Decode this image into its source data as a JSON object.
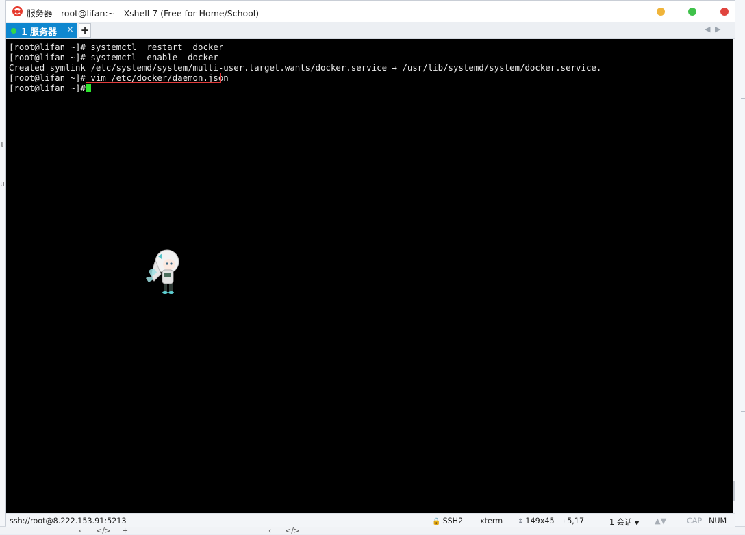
{
  "window": {
    "title": "服务器 - root@lifan:~ - Xshell 7 (Free for Home/School)"
  },
  "tabs": [
    {
      "number": "1",
      "label": "服务器",
      "close": "×",
      "active": true
    }
  ],
  "tab_add_label": "+",
  "tab_nav": {
    "prev": "◀",
    "next": "▶"
  },
  "terminal": {
    "lines": [
      "[root@lifan ~]# systemctl  restart  docker",
      "[root@lifan ~]# systemctl  enable  docker",
      "Created symlink /etc/systemd/system/multi-user.target.wants/docker.service → /usr/lib/systemd/system/docker.service.",
      "[root@lifan ~]# vim /etc/docker/daemon.json",
      "[root@lifan ~]# "
    ],
    "highlighted_command": "vim /etc/docker/daemon.json",
    "cursor_color": "#2ee62e",
    "highlight_color": "#e03a3a"
  },
  "status": {
    "connection": "ssh://root@8.222.153.91:5213",
    "protocol": "SSH2",
    "terminal_type": "xterm",
    "size": "149x45",
    "cursor_pos": "5,17",
    "sessions": "1 会话",
    "caps": "CAP",
    "num": "NUM"
  },
  "background_fragments": {
    "left_1": "li",
    "left_2": "un"
  },
  "colors": {
    "tab_active_bg": "#0f87cf",
    "terminal_bg": "#000000",
    "min_button": "#f0b43a",
    "max_button": "#3fc14a",
    "close_button": "#e0443e"
  }
}
